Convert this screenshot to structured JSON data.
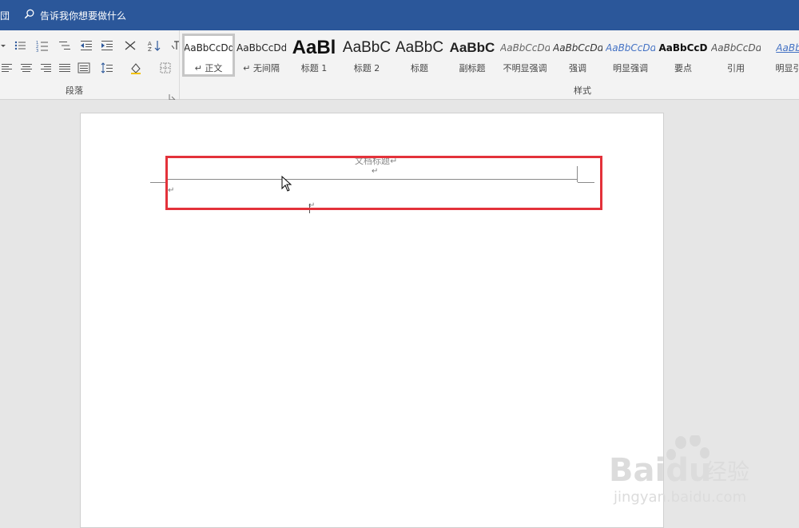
{
  "titlebar": {
    "left_fragment": "団",
    "search_placeholder": "告诉我你想要做什么"
  },
  "ribbon": {
    "paragraph_group_label": "段落",
    "styles_group_label": "样式",
    "styles": [
      {
        "sample": "AaBbCcDd",
        "name": "↵ 正文",
        "selected": true
      },
      {
        "sample": "AaBbCcDd",
        "name": "↵ 无间隔"
      },
      {
        "sample": "AaBl",
        "name": "标题 1"
      },
      {
        "sample": "AaBbC",
        "name": "标题 2"
      },
      {
        "sample": "AaBbC",
        "name": "标题"
      },
      {
        "sample": "AaBbC",
        "name": "副标题"
      },
      {
        "sample": "AaBbCcDd",
        "name": "不明显强调"
      },
      {
        "sample": "AaBbCcDd",
        "name": "强调"
      },
      {
        "sample": "AaBbCcDd",
        "name": "明显强调"
      },
      {
        "sample": "AaBbCcD",
        "name": "要点"
      },
      {
        "sample": "AaBbCcDd",
        "name": "引用"
      },
      {
        "sample": "AaBb",
        "name": "明显引"
      }
    ]
  },
  "document": {
    "header_text": "文档标题↵",
    "return_mark": "↵"
  },
  "watermark": {
    "brand": "Baidu",
    "brand_cn": "经验",
    "url": "jingyan.baidu.com"
  },
  "colors": {
    "titlebar": "#2b579a",
    "highlight_box": "#e3323a"
  }
}
